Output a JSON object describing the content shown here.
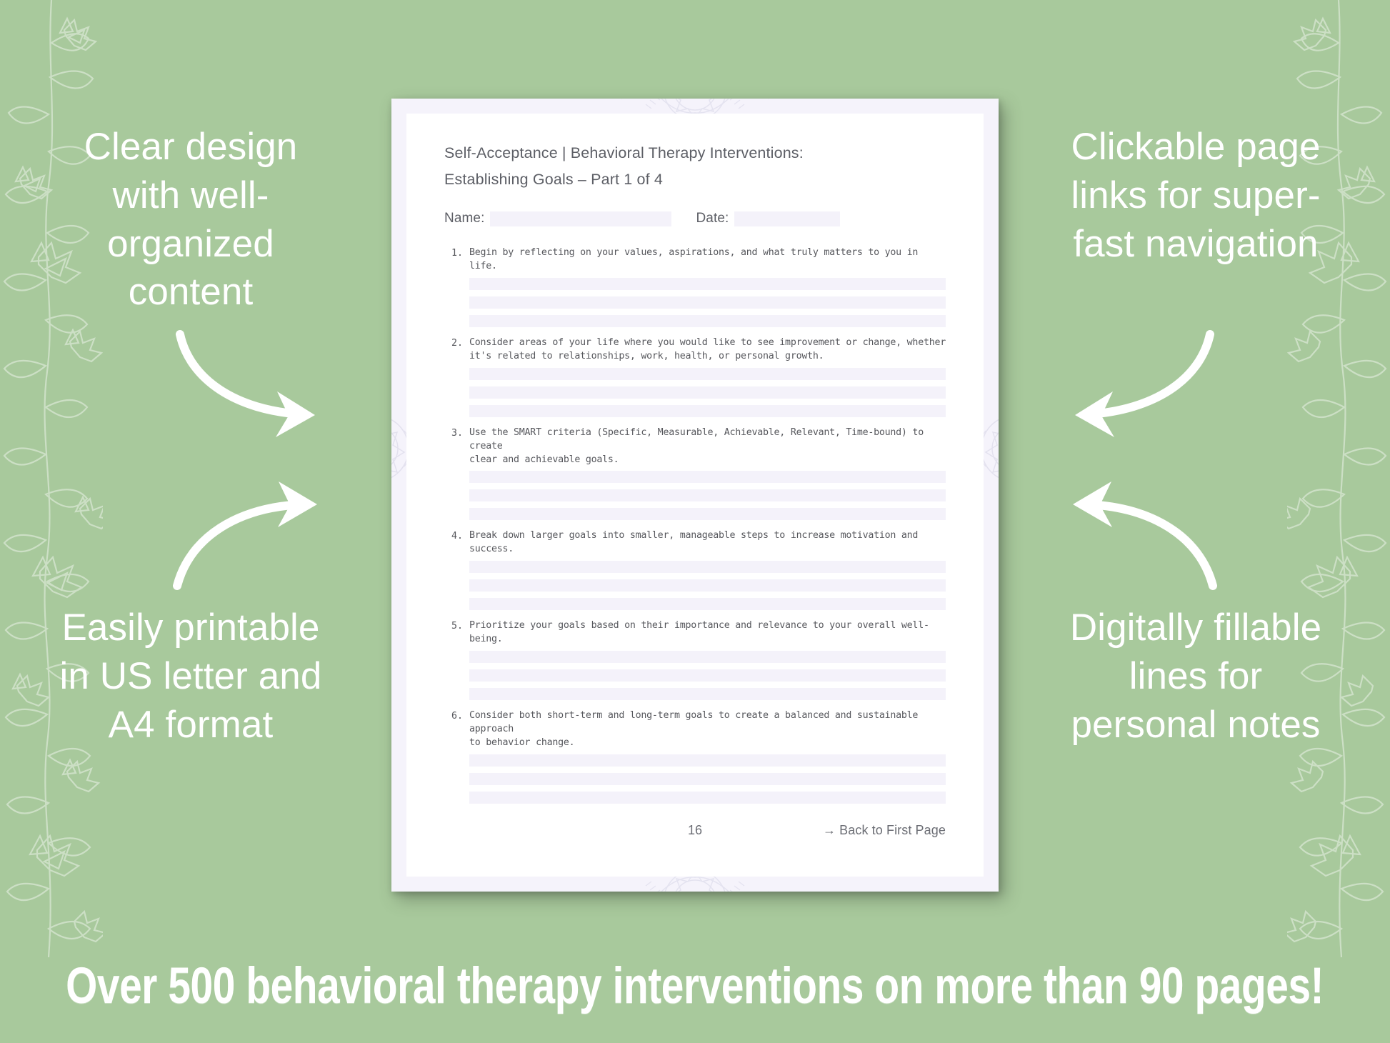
{
  "theme": {
    "background_green": "#a8c99c",
    "page_border_lavender": "#f5f3fb",
    "sheet_white": "#ffffff",
    "fill_line_lavender": "#f4f2fa",
    "body_text_gray": "#57585d",
    "promo_text_white": "#ffffff"
  },
  "promos": {
    "top_left": "Clear design with well-organized content",
    "bottom_left": "Easily printable in US letter and A4 format",
    "top_right": "Clickable page links for super-fast navigation",
    "bottom_right": "Digitally fillable lines for personal notes"
  },
  "banner": {
    "text": "Over 500 behavioral therapy interventions on more than 90 pages!"
  },
  "worksheet": {
    "title_line1": "Self-Acceptance | Behavioral Therapy Interventions:",
    "title_line2": "Establishing Goals   – Part 1 of 4",
    "name_label": "Name:",
    "date_label": "Date:",
    "name_value": "",
    "date_value": "",
    "items": [
      {
        "number": "1.",
        "text": "Begin by reflecting on your values, aspirations, and what truly matters to you in life.",
        "lines": 3
      },
      {
        "number": "2.",
        "text": "Consider areas of your life where you would like to see improvement or change, whether\nit's related to relationships, work, health, or personal growth.",
        "lines": 3
      },
      {
        "number": "3.",
        "text": "Use the SMART criteria (Specific, Measurable, Achievable, Relevant, Time-bound) to create\nclear and achievable goals.",
        "lines": 3
      },
      {
        "number": "4.",
        "text": "Break down larger goals into smaller, manageable steps to increase motivation and success.",
        "lines": 3
      },
      {
        "number": "5.",
        "text": "Prioritize your goals based on their importance and relevance to your overall well-being.",
        "lines": 3
      },
      {
        "number": "6.",
        "text": "Consider both short-term and long-term goals to create a balanced and sustainable approach\nto behavior change.",
        "lines": 3
      }
    ],
    "footer": {
      "page_number": "16",
      "back_link": "→ Back to First Page"
    }
  }
}
